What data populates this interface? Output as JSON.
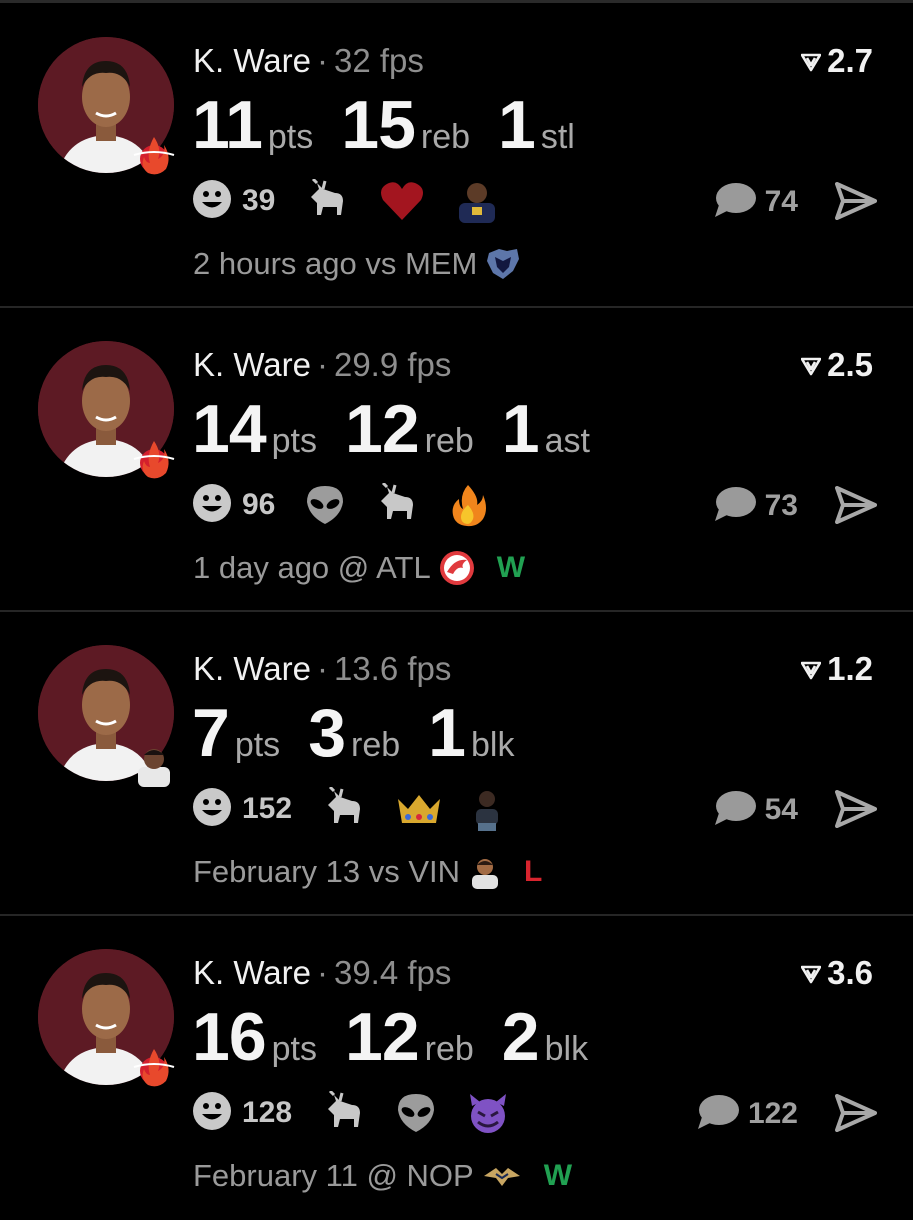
{
  "colors": {
    "background": "#000000",
    "win": "#21a152",
    "loss": "#d8242e",
    "muted": "#8e8e8e",
    "avatar_bg": "#5d1a24"
  },
  "posts": [
    {
      "player": "K. Ware",
      "separator": "·",
      "fps": "32 fps",
      "score": "2.7",
      "stats": [
        {
          "value": "11",
          "unit": "pts"
        },
        {
          "value": "15",
          "unit": "reb"
        },
        {
          "value": "1",
          "unit": "stl"
        }
      ],
      "reaction_count": "39",
      "reaction_icons": [
        "goat-icon",
        "heart-icon",
        "player-avatar-icon"
      ],
      "comment_count": "74",
      "time": "2 hours ago vs MEM",
      "opponent_logo": "grizzlies-logo-icon",
      "result": "",
      "badge": "heat-logo-icon"
    },
    {
      "player": "K. Ware",
      "separator": "·",
      "fps": "29.9 fps",
      "score": "2.5",
      "stats": [
        {
          "value": "14",
          "unit": "pts"
        },
        {
          "value": "12",
          "unit": "reb"
        },
        {
          "value": "1",
          "unit": "ast"
        }
      ],
      "reaction_count": "96",
      "reaction_icons": [
        "alien-icon",
        "goat-icon",
        "fire-icon"
      ],
      "comment_count": "73",
      "time": "1 day ago @ ATL",
      "opponent_logo": "hawks-logo-icon",
      "result": "W",
      "badge": "heat-logo-icon"
    },
    {
      "player": "K. Ware",
      "separator": "·",
      "fps": "13.6 fps",
      "score": "1.2",
      "stats": [
        {
          "value": "7",
          "unit": "pts"
        },
        {
          "value": "3",
          "unit": "reb"
        },
        {
          "value": "1",
          "unit": "blk"
        }
      ],
      "reaction_count": "152",
      "reaction_icons": [
        "goat-icon",
        "crown-icon",
        "person-avatar-icon"
      ],
      "comment_count": "54",
      "time": "February 13 vs VIN",
      "opponent_logo": "player-avatar-icon",
      "result": "L",
      "badge": "player-avatar-icon"
    },
    {
      "player": "K. Ware",
      "separator": "·",
      "fps": "39.4 fps",
      "score": "3.6",
      "stats": [
        {
          "value": "16",
          "unit": "pts"
        },
        {
          "value": "12",
          "unit": "reb"
        },
        {
          "value": "2",
          "unit": "blk"
        }
      ],
      "reaction_count": "128",
      "reaction_icons": [
        "goat-icon",
        "alien-icon",
        "devil-icon"
      ],
      "comment_count": "122",
      "time": "February 11 @ NOP",
      "opponent_logo": "pelicans-logo-icon",
      "result": "W",
      "badge": "heat-logo-icon"
    }
  ]
}
